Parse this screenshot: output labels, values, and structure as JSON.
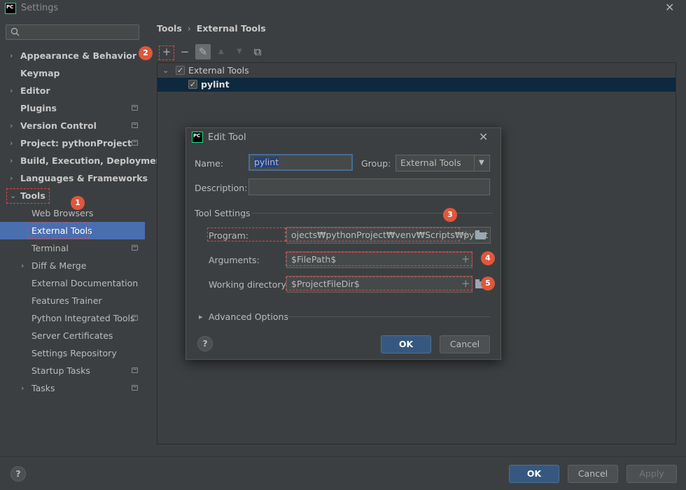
{
  "window": {
    "title": "Settings",
    "close_glyph": "✕"
  },
  "search": {
    "placeholder": ""
  },
  "sidebar": {
    "items": [
      {
        "label": "Appearance & Behavior",
        "arrow": "›",
        "bold": true,
        "project": false
      },
      {
        "label": "Keymap",
        "arrow": "",
        "bold": true,
        "project": false
      },
      {
        "label": "Editor",
        "arrow": "›",
        "bold": true,
        "project": false
      },
      {
        "label": "Plugins",
        "arrow": "",
        "bold": true,
        "project": true
      },
      {
        "label": "Version Control",
        "arrow": "›",
        "bold": true,
        "project": true
      },
      {
        "label": "Project: pythonProject",
        "arrow": "›",
        "bold": true,
        "project": true
      },
      {
        "label": "Build, Execution, Deployment",
        "arrow": "›",
        "bold": true,
        "project": false
      },
      {
        "label": "Languages & Frameworks",
        "arrow": "›",
        "bold": true,
        "project": false
      },
      {
        "label": "Tools",
        "arrow": "⌄",
        "bold": true,
        "project": false
      },
      {
        "label": "Web Browsers",
        "arrow": "",
        "bold": false,
        "project": false
      },
      {
        "label": "External Tools",
        "arrow": "",
        "bold": false,
        "project": false,
        "selected": true
      },
      {
        "label": "Terminal",
        "arrow": "",
        "bold": false,
        "project": true
      },
      {
        "label": "Diff & Merge",
        "arrow": "›",
        "bold": false,
        "project": false
      },
      {
        "label": "External Documentation",
        "arrow": "",
        "bold": false,
        "project": false
      },
      {
        "label": "Features Trainer",
        "arrow": "",
        "bold": false,
        "project": false
      },
      {
        "label": "Python Integrated Tools",
        "arrow": "",
        "bold": false,
        "project": true
      },
      {
        "label": "Server Certificates",
        "arrow": "",
        "bold": false,
        "project": false
      },
      {
        "label": "Settings Repository",
        "arrow": "",
        "bold": false,
        "project": false
      },
      {
        "label": "Startup Tasks",
        "arrow": "",
        "bold": false,
        "project": true
      },
      {
        "label": "Tasks",
        "arrow": "›",
        "bold": false,
        "project": true
      }
    ]
  },
  "breadcrumb": {
    "parent": "Tools",
    "sep": "›",
    "current": "External Tools"
  },
  "toolbar": {
    "add": "+",
    "remove": "−",
    "edit": "✎",
    "up": "▲",
    "down": "▼",
    "copy": "⧉"
  },
  "tree": {
    "group": {
      "arrow": "⌄",
      "check": "✓",
      "label": "External Tools"
    },
    "item": {
      "check": "✓",
      "label": "pylint"
    }
  },
  "badges": [
    "1",
    "2",
    "3",
    "4",
    "5"
  ],
  "dialog": {
    "title": "Edit Tool",
    "close_glyph": "✕",
    "name_label": "Name:",
    "name_value": "pylint",
    "group_label": "Group:",
    "group_value": "External Tools",
    "description_label": "Description:",
    "description_value": "",
    "tool_settings_label": "Tool Settings",
    "program_label": "Program:",
    "program_value": "ojects₩pythonProject₩venv₩Scripts₩pylint",
    "arguments_label": "Arguments:",
    "arguments_value": "$FilePath$",
    "workdir_label": "Working directory:",
    "workdir_value": "$ProjectFileDir$",
    "plus_glyph": "+",
    "advanced_arrow": "▸",
    "advanced_label": "Advanced Options",
    "help": "?",
    "ok": "OK",
    "cancel": "Cancel"
  },
  "footer": {
    "help": "?",
    "ok": "OK",
    "cancel": "Cancel",
    "apply": "Apply"
  },
  "colors": {
    "selection": "#4b6eaf",
    "badge": "#e0573b",
    "highlight_box": "#e04646",
    "primary_button": "#365880"
  }
}
